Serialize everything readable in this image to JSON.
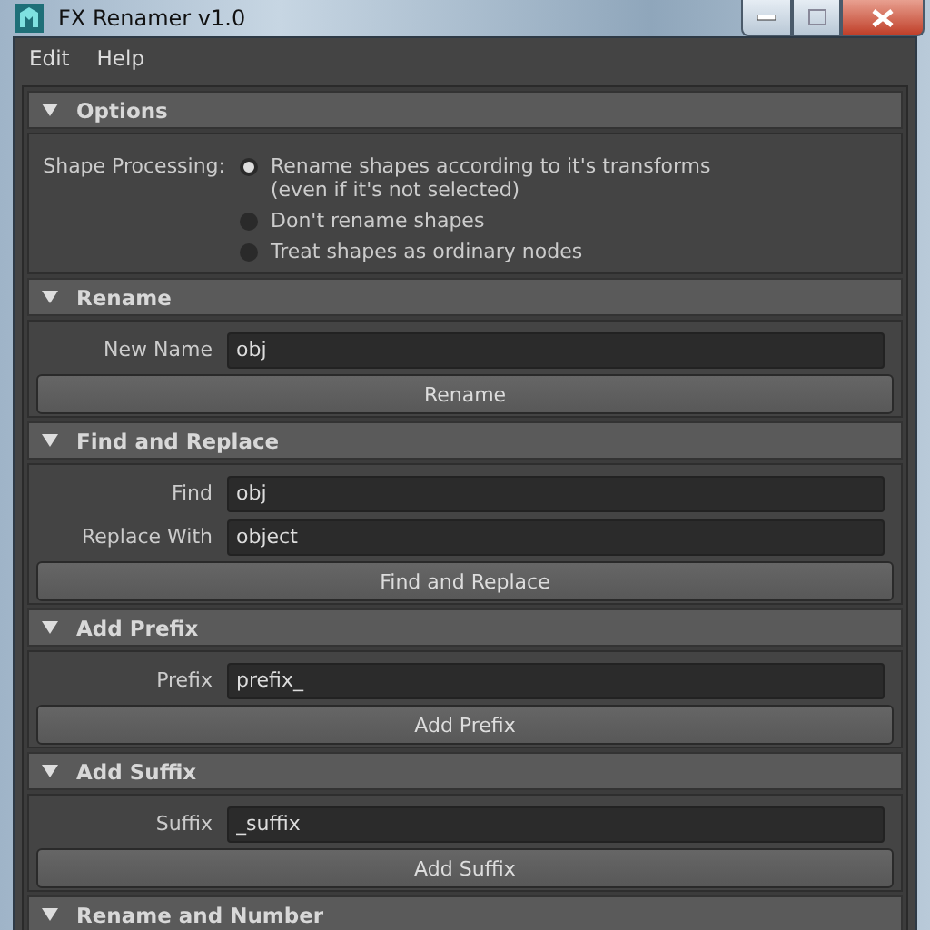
{
  "window": {
    "title": "FX Renamer v1.0"
  },
  "menu": [
    "Edit",
    "Help"
  ],
  "sections": [
    {
      "kind": "options",
      "title": "Options",
      "expanded": true,
      "label": "Shape Processing:",
      "options": [
        {
          "lines": [
            "Rename shapes according to it's transforms",
            "(even if it's not selected)"
          ],
          "selected": true
        },
        {
          "lines": [
            "Don't rename shapes"
          ],
          "selected": false
        },
        {
          "lines": [
            "Treat shapes as ordinary nodes"
          ],
          "selected": false
        }
      ]
    },
    {
      "kind": "form",
      "title": "Rename",
      "expanded": true,
      "fields": [
        {
          "label": "New Name",
          "value": "obj"
        }
      ],
      "button": "Rename"
    },
    {
      "kind": "form",
      "title": "Find and Replace",
      "expanded": true,
      "fields": [
        {
          "label": "Find",
          "value": "obj"
        },
        {
          "label": "Replace With",
          "value": "object"
        }
      ],
      "button": "Find and Replace"
    },
    {
      "kind": "form",
      "title": "Add Prefix",
      "expanded": true,
      "fields": [
        {
          "label": "Prefix",
          "value": "prefix_"
        }
      ],
      "button": "Add Prefix"
    },
    {
      "kind": "form",
      "title": "Add Suffix",
      "expanded": true,
      "fields": [
        {
          "label": "Suffix",
          "value": "_suffix"
        }
      ],
      "button": "Add Suffix"
    },
    {
      "kind": "form",
      "title": "Rename and Number",
      "expanded": true
    }
  ]
}
